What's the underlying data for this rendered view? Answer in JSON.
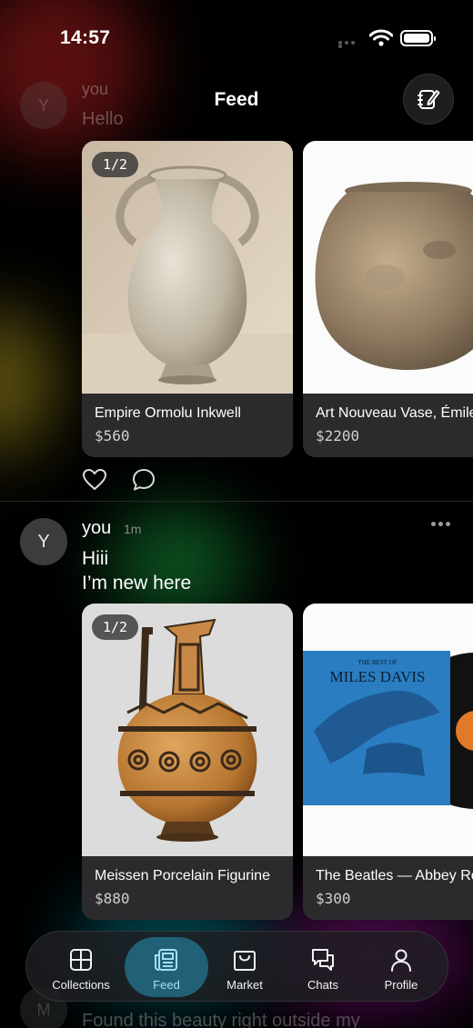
{
  "status_bar": {
    "time": "14:57"
  },
  "header": {
    "title": "Feed",
    "compose_icon": "compose-icon"
  },
  "faded_top_post": {
    "avatar_letter": "Y",
    "author": "you",
    "text": "Hello"
  },
  "posts": [
    {
      "cards": [
        {
          "title": "Empire Ormolu Inkwell",
          "price": "$560",
          "pager": "1/2"
        },
        {
          "title": "Art Nouveau Vase, Émile Gallé",
          "price": "$2200"
        }
      ],
      "actions": [
        "heart-icon",
        "comment-icon"
      ]
    },
    {
      "avatar_letter": "Y",
      "author": "you",
      "time_ago": "1m",
      "text_line1": "Hiii",
      "text_line2": "I’m new here",
      "cards": [
        {
          "title": "Meissen Porcelain Figurine",
          "price": "$880",
          "pager": "1/2"
        },
        {
          "title": "The Beatles — Abbey Road",
          "price": "$300"
        }
      ]
    }
  ],
  "record_cover": {
    "top": "THE BEST OF",
    "name": "MILES DAVIS"
  },
  "faded_bottom_post": {
    "avatar_letter": "M",
    "text": "Found this beauty right outside my"
  },
  "tab_bar": {
    "active": "Feed",
    "tabs": [
      {
        "label": "Collections",
        "icon": "grid-icon"
      },
      {
        "label": "Feed",
        "icon": "feed-icon"
      },
      {
        "label": "Market",
        "icon": "bag-icon"
      },
      {
        "label": "Chats",
        "icon": "chat-icon"
      },
      {
        "label": "Profile",
        "icon": "person-icon"
      }
    ]
  },
  "colors": {
    "background": "#000000",
    "active_tab": "#2896b9",
    "card": "#2b2b2d"
  }
}
